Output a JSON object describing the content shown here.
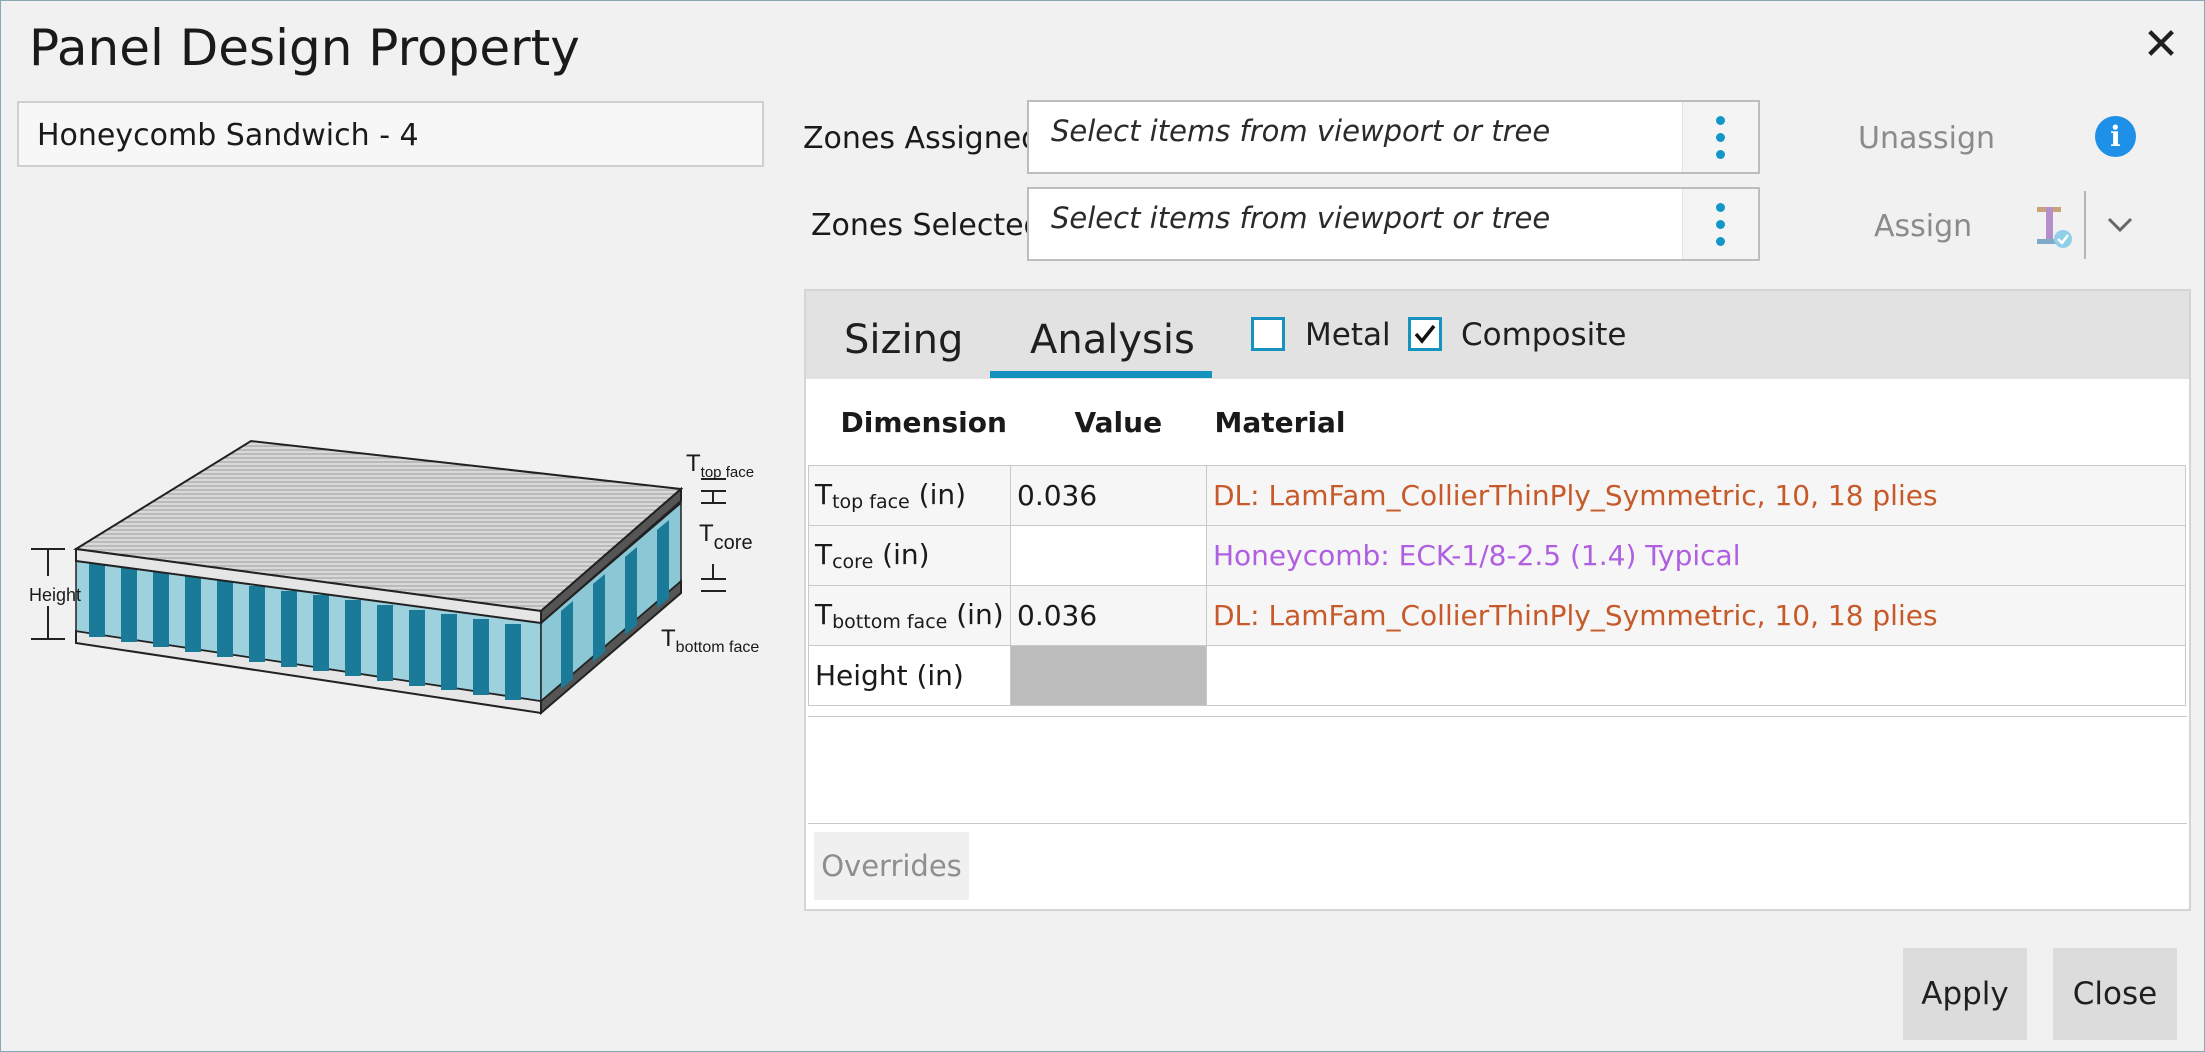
{
  "window": {
    "title": "Panel Design Property",
    "close_glyph": "✕"
  },
  "property_name": "Honeycomb Sandwich - 4",
  "illustration": {
    "labels": {
      "t": "T",
      "top_face": "top face",
      "core": "core",
      "bottom_face": "bottom face",
      "height": "Height"
    }
  },
  "zones": {
    "assigned_label": "Zones Assigned:",
    "selected_label": "Zones Selected:",
    "placeholder": "Select items from viewport or tree",
    "unassign": "Unassign",
    "assign": "Assign"
  },
  "tabs": {
    "sizing": "Sizing",
    "analysis": "Analysis",
    "active": "Analysis"
  },
  "checkboxes": {
    "metal": {
      "label": "Metal",
      "checked": false
    },
    "composite": {
      "label": "Composite",
      "checked": true
    }
  },
  "table": {
    "headers": {
      "dimension": "Dimension",
      "value": "Value",
      "material": "Material"
    },
    "rows": [
      {
        "dim": "T",
        "sub": "top face",
        "unit": "(in)",
        "value": "0.036",
        "material": "DL: LamFam_CollierThinPly_Symmetric, 10, 18 plies"
      },
      {
        "dim": "T",
        "sub": "core",
        "unit": "(in)",
        "value": "",
        "material": "Honeycomb: ECK-1/8-2.5 (1.4) Typical"
      },
      {
        "dim": "T",
        "sub": "bottom face",
        "unit": "(in)",
        "value": "0.036",
        "material": "DL: LamFam_CollierThinPly_Symmetric, 10, 18 plies"
      },
      {
        "dim": "Height",
        "sub": "",
        "unit": "(in)",
        "value": "",
        "material": ""
      }
    ]
  },
  "overrides": "Overrides",
  "buttons": {
    "apply": "Apply",
    "close": "Close"
  },
  "colors": {
    "accent": "#1592bd",
    "info": "#1e90e8",
    "material_orange": "#c75a2a",
    "material_purple": "#b05fe0",
    "core_teal": "#1a7a98"
  },
  "icons": {
    "close": "close-icon",
    "kebab": "kebab-menu-icon",
    "info": "info-icon",
    "tools": "material-tools-icon",
    "dropdown": "chevron-down-icon",
    "check": "checkmark-icon"
  }
}
